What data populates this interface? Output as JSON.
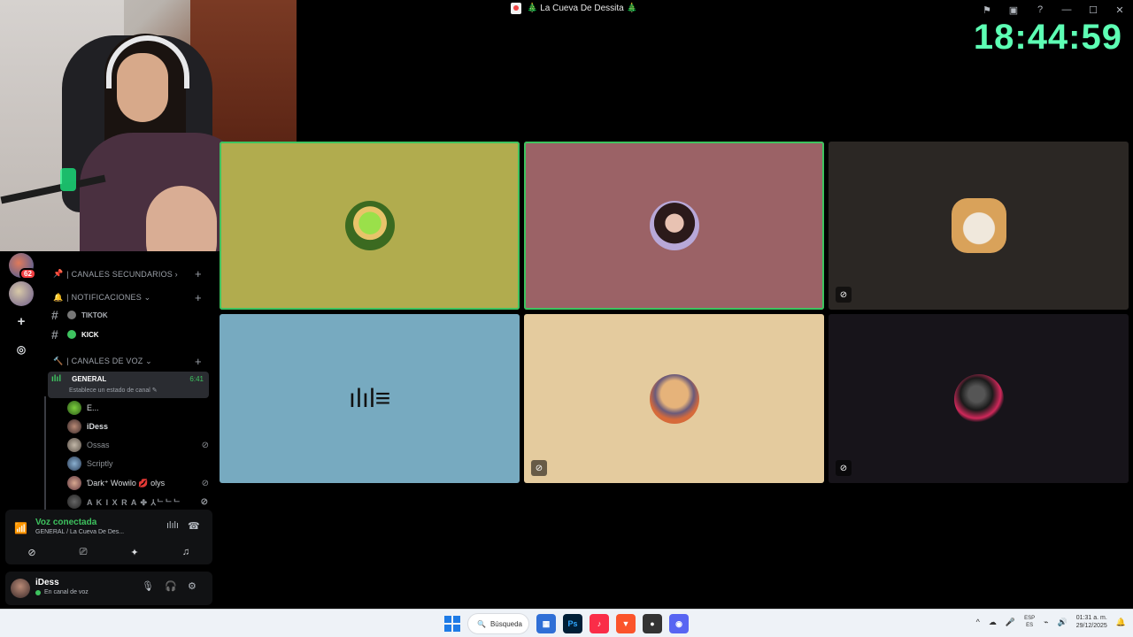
{
  "window": {
    "title": "🎄 La Cueva De Dessita 🎄",
    "icons": [
      "flag-icon",
      "screen-icon",
      "help-icon",
      "minimize-icon",
      "maximize-icon",
      "close-icon"
    ]
  },
  "clock": "18:44:59",
  "servers": {
    "badge": "62"
  },
  "channels": {
    "categories": [
      {
        "label": "| CANALES SECUNDARIOS ›",
        "icon": "📌"
      },
      {
        "label": "| NOTIFICACIONES ⌄",
        "icon": "🔔"
      },
      {
        "label": "| CANALES DE VOZ ⌄",
        "icon": "🔨"
      }
    ],
    "text_channels": [
      {
        "label": "TIKTOK"
      },
      {
        "label": "KICK"
      }
    ],
    "voice_channel": {
      "label": "GENERAL",
      "time": "6:41",
      "status_hint": "Establece un estado de canal ✎"
    },
    "members": [
      {
        "name": "E...",
        "muted": false
      },
      {
        "name": "iDess",
        "muted": false
      },
      {
        "name": "Ossas",
        "muted": true
      },
      {
        "name": "Scriptly",
        "muted": false
      },
      {
        "name": "Ɗark⁺ Wowilo 💋 olys",
        "muted": true
      },
      {
        "name": "A K I X R A ✤ ⅄ᄂᄂᄂ",
        "muted": true
      }
    ]
  },
  "voice_panel": {
    "status": "Voz conectada",
    "location": "GENERAL / La Cueva De Des...",
    "buttons": [
      "camera-off-icon",
      "screen-share-icon",
      "activities-icon",
      "soundboard-icon"
    ]
  },
  "user_panel": {
    "name": "iDess",
    "status": "En canal de voz"
  },
  "tiles": [
    {
      "bg": "#b1ac4e",
      "speaking": true,
      "muted": false,
      "avatar": "green-monster"
    },
    {
      "bg": "#9b6266",
      "speaking": true,
      "muted": false,
      "avatar": "girl-sunglasses"
    },
    {
      "bg": "#2b2724",
      "speaking": false,
      "muted": true,
      "avatar": "cat-frame"
    },
    {
      "bg": "#77aac0",
      "speaking": false,
      "muted": false,
      "avatar": "audio-wave"
    },
    {
      "bg": "#e4cb9e",
      "speaking": false,
      "muted": true,
      "avatar": "dog"
    },
    {
      "bg": "#17141a",
      "speaking": false,
      "muted": true,
      "avatar": "dark-orb"
    }
  ],
  "taskbar": {
    "search_label": "Búsqueda",
    "lang_top": "ESP",
    "lang_bottom": "ES",
    "time": "01:31 a. m.",
    "date": "29/12/2025"
  }
}
